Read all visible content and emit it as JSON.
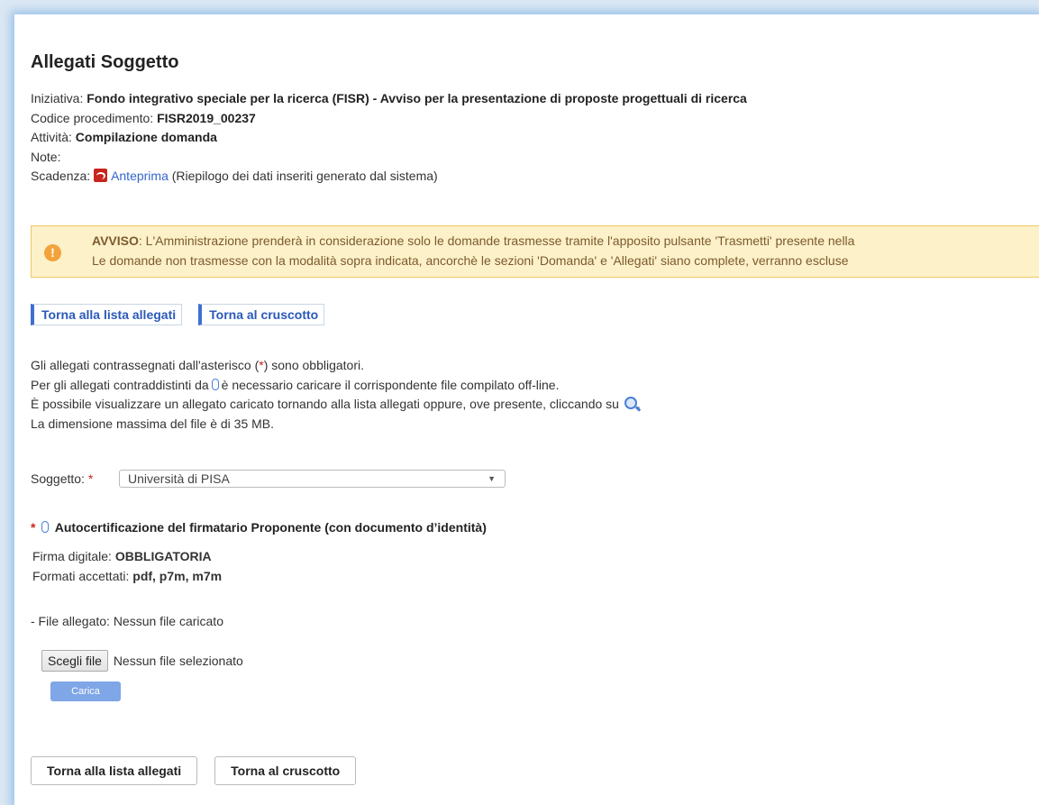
{
  "page": {
    "title": "Allegati Soggetto"
  },
  "meta": {
    "iniziativa_label": "Iniziativa:",
    "iniziativa_value": "Fondo integrativo speciale per la ricerca (FISR) - Avviso per la presentazione di proposte progettuali di ricerca",
    "codice_label": "Codice procedimento:",
    "codice_value": "FISR2019_00237",
    "attivita_label": "Attività:",
    "attivita_value": "Compilazione domanda",
    "note_label": "Note:",
    "scadenza_label": "Scadenza:",
    "anteprima_link": "Anteprima",
    "anteprima_desc": "(Riepilogo dei dati inseriti generato dal sistema)"
  },
  "alert": {
    "label": "AVVISO",
    "line1": ": L'Amministrazione prenderà in considerazione solo le domande trasmesse tramite l'apposito pulsante 'Trasmetti' presente nella",
    "line2": "Le domande non trasmesse con la modalità sopra indicata, ancorchè le sezioni 'Domanda' e 'Allegati' siano complete, verranno escluse"
  },
  "tabs": {
    "back_to_list": "Torna alla lista allegati",
    "back_to_dashboard": "Torna al cruscotto"
  },
  "info": {
    "line1_pre": "Gli allegati contrassegnati dall'asterisco (",
    "asterisk": "*",
    "line1_post": ") sono obbligatori.",
    "line2_pre": "Per gli allegati contraddistinti da",
    "line2_post": "è necessario caricare il corrispondente file compilato off-line.",
    "line3": "È possibile visualizzare un allegato caricato tornando alla lista allegati oppure, ove presente, cliccando su",
    "line3_end": ".",
    "line4": "La dimensione massima del file è di 35 MB."
  },
  "soggetto": {
    "label": "Soggetto:",
    "required": "*",
    "selected": "Università di PISA"
  },
  "document": {
    "required": "*",
    "title": "Autocertificazione del firmatario Proponente (con documento d’identità)",
    "firma_label": "Firma digitale:",
    "firma_value": "OBBLIGATORIA",
    "formati_label": "Formati accettati:",
    "formati_value": "pdf, p7m, m7m",
    "file_label": "- File allegato: Nessun file caricato",
    "choose_btn": "Scegli file",
    "file_status": "Nessun file selezionato",
    "upload_btn": "Carica"
  },
  "bottom": {
    "back_to_list": "Torna alla lista allegati",
    "back_to_dashboard": "Torna al cruscotto"
  },
  "colors": {
    "link": "#3366cc",
    "accent": "#3f6fd2",
    "alert_bg": "#fcf1c9",
    "required": "#d0211a"
  }
}
